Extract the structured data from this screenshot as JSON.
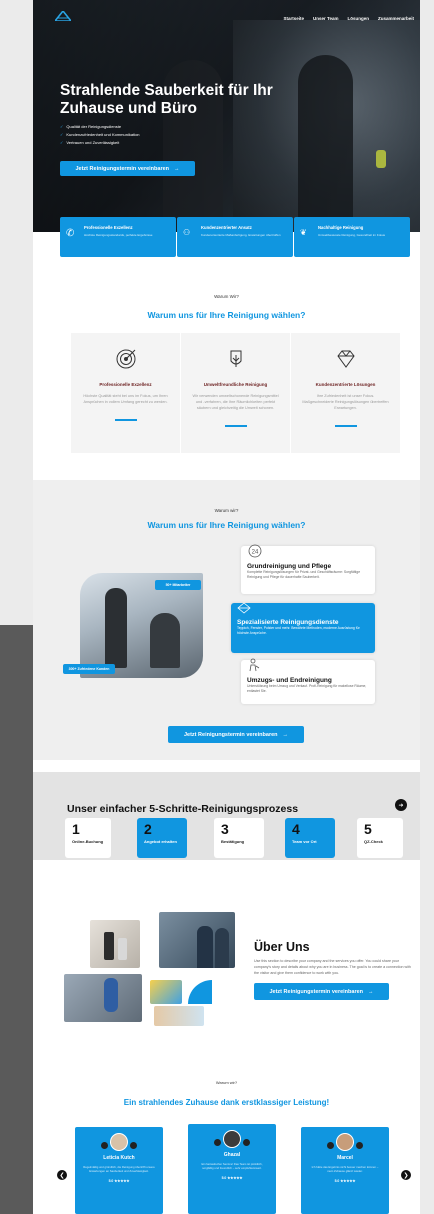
{
  "nav": {
    "items": [
      "Startseite",
      "Unser Team",
      "Lösungen",
      "Zusammenarbeit"
    ]
  },
  "hero": {
    "title": "Strahlende Sauberkeit für Ihr Zuhause und Büro",
    "checks": [
      "Qualität der Reinigungsdienste",
      "Kundenzufriedenheit und Kommunikation",
      "Vertrauen und Zuverlässigkeit"
    ],
    "cta": "Jetzt Reinigungstermin vereinbaren"
  },
  "features": [
    {
      "title": "Professionelle Exzellenz",
      "desc": "Höchste Reinigungsstandards, perfekte Ergebnisse",
      "icon": "phone-icon"
    },
    {
      "title": "Kundenzentrierter Ansatz",
      "desc": "Kundenorientierte Maßanfertigung, Erwartungen übertroffen",
      "icon": "people-icon"
    },
    {
      "title": "Nachhaltige Reinigung",
      "desc": "Umweltbewusste Reinigung, Gesundheit im Fokus",
      "icon": "plant-icon"
    }
  ],
  "why1": {
    "eyebrow": "Warum Wir?",
    "title": "Warum uns für Ihre Reinigung wählen?",
    "cards": [
      {
        "title": "Professionelle Exzellenz",
        "desc": "Höchste Qualität steht bei uns im Fokus, um Ihren Ansprüchen in vollem Umfang gerecht zu werden.",
        "icon": "target-icon"
      },
      {
        "title": "Umweltfreundliche Reinigung",
        "desc": "Wir verwenden umweltschonende Reinigungsmittel und -verfahren, die Ihre Räumlichkeiten perfekt säubern und gleichzeitig die Umwelt schonen.",
        "icon": "eco-icon"
      },
      {
        "title": "Kundenzentrierte Lösungen",
        "desc": "Ihre Zufriedenheit ist unser Fokus. Maßgeschneiderte Reinigungslösungen übertreffen Erwartungen.",
        "icon": "diamond-icon"
      }
    ]
  },
  "why2": {
    "eyebrow": "Warum wir?",
    "title": "Warum uns für Ihre Reinigung wählen?",
    "badge1": "50+ Mitarbeiter",
    "badge2": "300+ Zufriedene Kunden",
    "services": [
      {
        "title": "Grundreinigung und Pflege",
        "desc": "Komplette Reinigungslösungen für Privat- und Geschäftsräume: Sorgfältige Reinigung und Pflege für dauerhafte Sauberkeit.",
        "icon": "clock-24-icon"
      },
      {
        "title": "Spezialisierte Reinigungsdienste",
        "desc": "Teppich, Fenster, Polster und mehr. Bewährte Methoden, moderne Ausrüstung für höchste Ansprüche.",
        "icon": "spray-icon"
      },
      {
        "title": "Umzugs- und Endreinigung",
        "desc": "Unterstützung beim Umzug und Verkauf. Profi-Reinigung für makellose Räume, entlastet Sie.",
        "icon": "cleaner-icon"
      }
    ],
    "cta": "Jetzt Reinigungstermin vereinbaren"
  },
  "process": {
    "title": "Unser einfacher 5-Schritte-Reinigungsprozess",
    "steps": [
      {
        "n": "1",
        "label": "Online-Buchung"
      },
      {
        "n": "2",
        "label": "Angebot erhalten"
      },
      {
        "n": "3",
        "label": "Bestätigung"
      },
      {
        "n": "4",
        "label": "Team vor Ort"
      },
      {
        "n": "5",
        "label": "QZ-Check"
      }
    ]
  },
  "about": {
    "title": "Über Uns",
    "text": "Use this section to describe your company and the services you offer. You could share your company's story and details about why you are in business. The goal is to create a connection with the visitor and give them confidence to work with you.",
    "cta": "Jetzt Reinigungstermin vereinbaren"
  },
  "testimonials": {
    "eyebrow": "Warum wir?",
    "title": "Ein strahlendes Zuhause dank erstklassiger Leistung!",
    "items": [
      {
        "name": "Leticia Kutch",
        "desc": "Regelmäßig und gründlich, die Reinigung übertrifft unsere Erwartungen an Sauberkeit und Zuverlässigkeit.",
        "rating": "5.0",
        "stars": "★★★★★"
      },
      {
        "name": "Ghazal",
        "desc": "Ein fantastischer Service! Das Team ist pünktlich, sorgfältig und freundlich – sehr empfehlenswert.",
        "rating": "5.0",
        "stars": "★★★★★"
      },
      {
        "name": "Marcel",
        "desc": "Ich hätte das Ergebnis nicht besser machen können – mein Zuhause glänzt wieder.",
        "rating": "5.0",
        "stars": "★★★★★"
      }
    ]
  },
  "colors": {
    "accent": "#1096e0",
    "dark": "#1e242b"
  }
}
